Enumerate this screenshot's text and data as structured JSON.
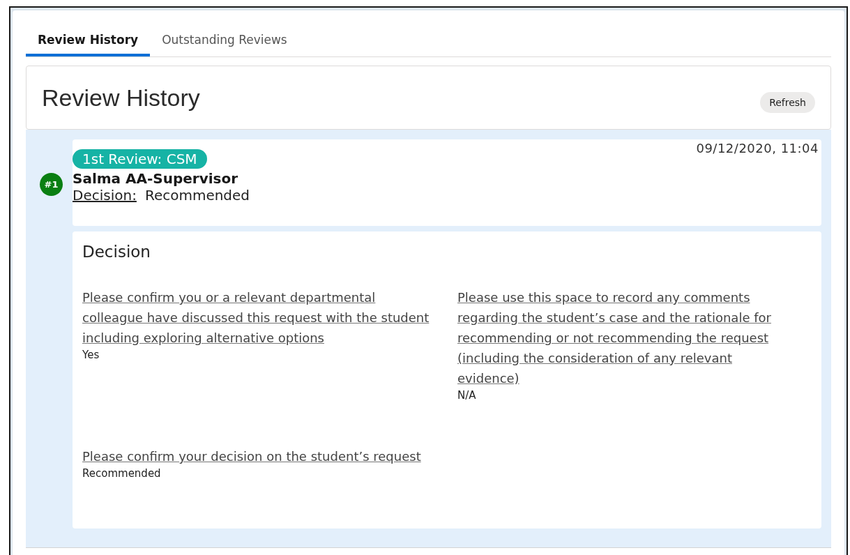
{
  "tabs": [
    {
      "label": "Review History",
      "selected": true
    },
    {
      "label": "Outstanding Reviews",
      "selected": false
    }
  ],
  "header": {
    "title": "Review History",
    "refresh_button": "Refresh"
  },
  "reviews": [
    {
      "number": "#1",
      "stage": "1st Review: CSM",
      "reviewer": "Salma AA-Supervisor",
      "decision_label": "Decision:",
      "decision": "Recommended",
      "timestamp": "09/12/2020, 11:04",
      "section_title": "Decision",
      "fields": [
        {
          "label": "Please confirm you or a relevant departmental colleague have discussed this request with the student including exploring alternative options",
          "value": "Yes"
        },
        {
          "label": "Please use this space to record any comments regarding the student’s case and the rationale for recommending or not recommending the request (including the consideration of any relevant evidence)",
          "value": "N/A"
        },
        {
          "label": "Please confirm your decision on the student’s request",
          "value": "Recommended"
        }
      ]
    }
  ]
}
